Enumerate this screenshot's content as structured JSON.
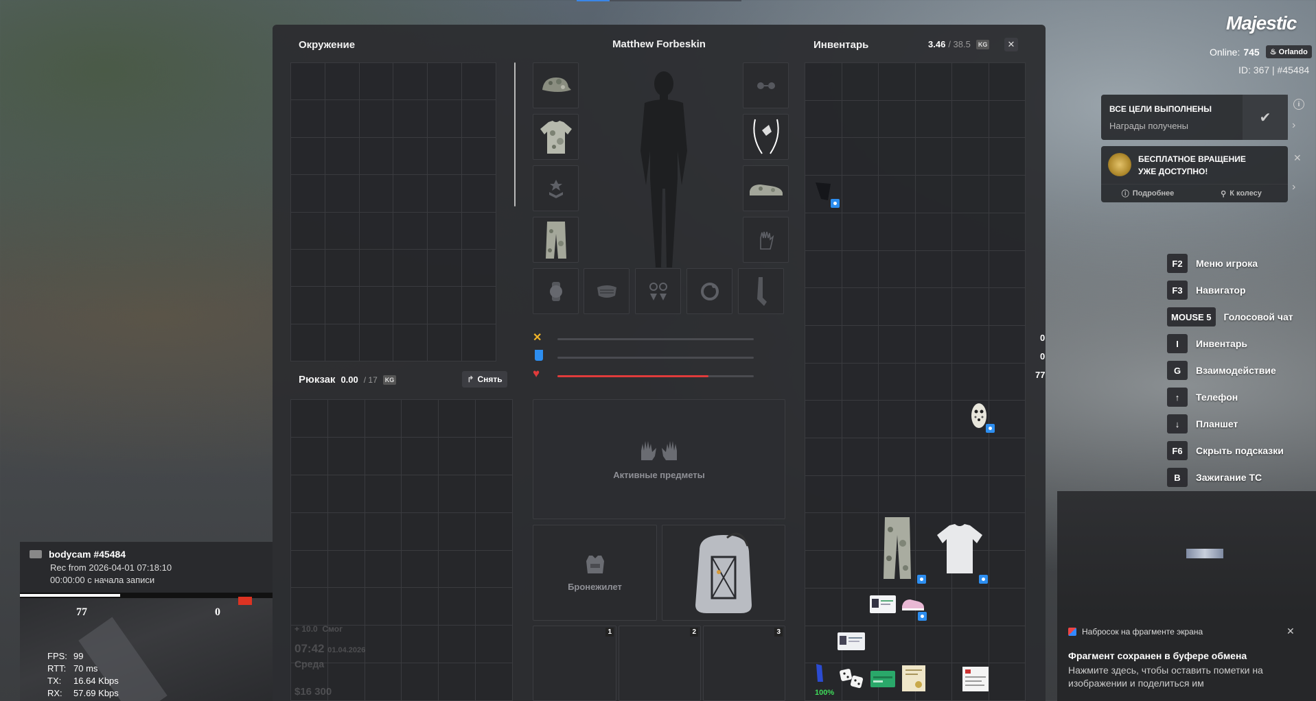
{
  "environment": {
    "title": "Окружение"
  },
  "character": {
    "name": "Matthew Forbeskin"
  },
  "inventory": {
    "title": "Инвентарь",
    "weight_current": "3.46",
    "weight_max": "/ 38.5",
    "kg": "KG"
  },
  "backpack": {
    "title": "Рюкзак",
    "weight_current": "0.00",
    "weight_max": "/ 17",
    "kg": "KG",
    "remove_label": "Снять"
  },
  "stats": [
    {
      "name": "hunger",
      "value": "0",
      "level": 0
    },
    {
      "name": "thirst",
      "value": "0",
      "level": 0
    },
    {
      "name": "health",
      "value": "77",
      "level": 0.77
    }
  ],
  "active_items": {
    "label": "Активные предметы"
  },
  "armor": {
    "label": "Бронежилет"
  },
  "hotbar": [
    "1",
    "2",
    "3"
  ],
  "inventory_items": {
    "stack_percent": "100%"
  },
  "brand": {
    "logo": "Majestic",
    "online_label": "Online:",
    "online_count": "745",
    "server": "Orlando",
    "id_line": "ID: 367 | #45484"
  },
  "goals": {
    "title": "ВСЕ ЦЕЛИ ВЫПОЛНЕНЫ",
    "subtitle": "Награды получены"
  },
  "spin": {
    "title_line1": "БЕСПЛАТНОЕ ВРАЩЕНИЕ",
    "title_line2": "УЖЕ ДОСТУПНО!",
    "more": "Подробнее",
    "wheel": "К колесу"
  },
  "hints": [
    {
      "key": "F2",
      "label": "Меню игрока"
    },
    {
      "key": "F3",
      "label": "Навигатор"
    },
    {
      "key": "MOUSE 5",
      "label": "Голосовой чат"
    },
    {
      "key": "I",
      "label": "Инвентарь"
    },
    {
      "key": "G",
      "label": "Взаимодействие"
    },
    {
      "key": "↑",
      "label": "Телефон"
    },
    {
      "key": "↓",
      "label": "Планшет"
    },
    {
      "key": "F6",
      "label": "Скрыть подсказки"
    },
    {
      "key": "B",
      "label": "Зажигание ТС"
    }
  ],
  "bodycam": {
    "title": "bodycam #45484",
    "rec": "Rec from 2026-04-01 07:18:10",
    "elapsed": "00:00:00 с начала записи",
    "left_num": "77",
    "right_num": "0"
  },
  "net": {
    "fps_label": "FPS:",
    "fps": "99",
    "rtt_label": "RTT:",
    "rtt": "70 ms",
    "tx_label": "TX:",
    "tx": "16.64 Kbps",
    "rx_label": "RX:",
    "rx": "57.69 Kbps"
  },
  "hud_faded": {
    "xp": "+ 10.0",
    "skill": "Смог",
    "time": "07:42",
    "date": "01.04.2026",
    "day": "Среда",
    "money": "$16 300"
  },
  "snip": {
    "app": "Набросок на фрагменте экрана",
    "title": "Фрагмент сохранен в буфере обмена",
    "body": "Нажмите здесь, чтобы оставить пометки на изображении и поделиться им"
  },
  "colors": {
    "accent_red": "#e03b3b",
    "badge_blue": "#2d8ef0",
    "hunger": "#f0b429",
    "thirst": "#2d8ef0"
  }
}
